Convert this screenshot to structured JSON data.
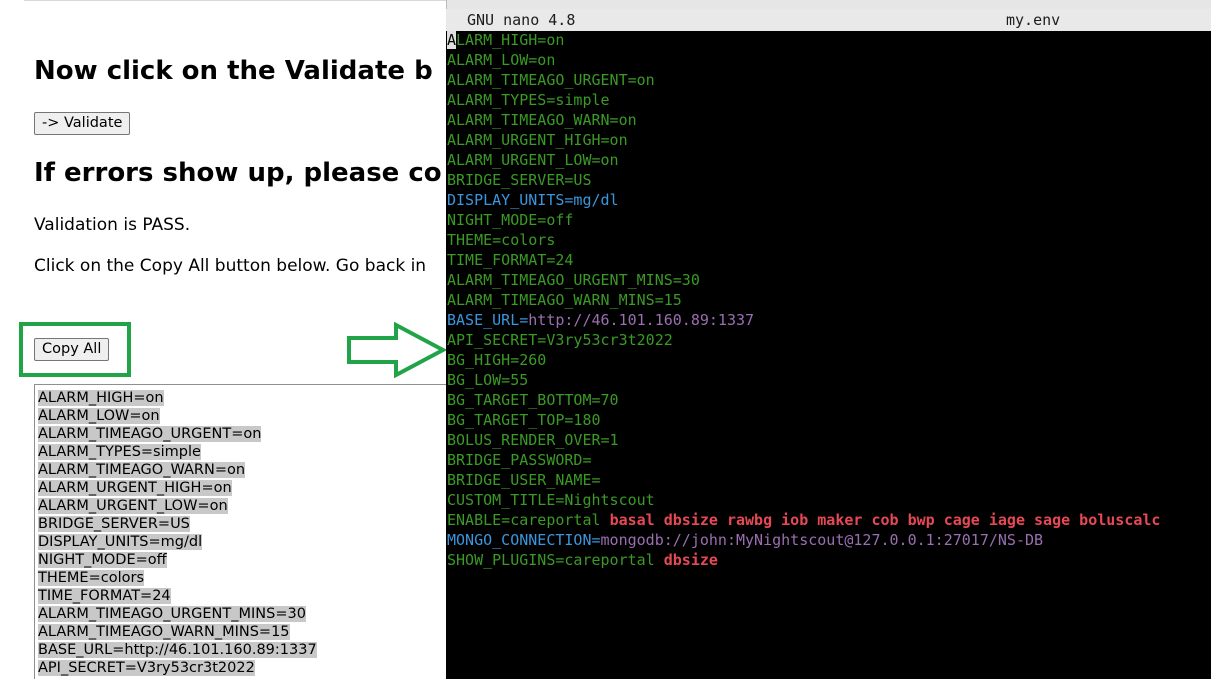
{
  "webpage": {
    "heading_validate": "Now click on the Validate b",
    "validate_button": "-> Validate",
    "heading_errors": "If errors show up, please co",
    "validation_status": "Validation is PASS.",
    "instruction": "Click on the Copy All button below. Go back in",
    "copy_all_button": "Copy All",
    "highlight_color": "#21a347",
    "textarea_lines": [
      "ALARM_HIGH=on",
      "ALARM_LOW=on",
      "ALARM_TIMEAGO_URGENT=on",
      "ALARM_TYPES=simple",
      "ALARM_TIMEAGO_WARN=on",
      "ALARM_URGENT_HIGH=on",
      "ALARM_URGENT_LOW=on",
      "BRIDGE_SERVER=US",
      "DISPLAY_UNITS=mg/dl",
      "NIGHT_MODE=off",
      "THEME=colors",
      "TIME_FORMAT=24",
      "ALARM_TIMEAGO_URGENT_MINS=30",
      "ALARM_TIMEAGO_WARN_MINS=15",
      "BASE_URL=http://46.101.160.89:1337",
      "API_SECRET=V3ry53cr3t2022"
    ]
  },
  "arrow": {
    "color": "#21a347",
    "icon": "right-arrow-icon"
  },
  "terminal": {
    "app_title": "GNU nano 4.8",
    "file_name": "my.env",
    "cursor_char": "A",
    "colors": {
      "green": "#3a9a25",
      "blue": "#3a96dd",
      "purple": "#9a6fb0",
      "red": "#e74856"
    },
    "lines": [
      {
        "segments": [
          {
            "text": "LARM_HIGH=on",
            "color": "green"
          }
        ]
      },
      {
        "segments": [
          {
            "text": "ALARM_LOW=on",
            "color": "green"
          }
        ]
      },
      {
        "segments": [
          {
            "text": "ALARM_TIMEAGO_URGENT=on",
            "color": "green"
          }
        ]
      },
      {
        "segments": [
          {
            "text": "ALARM_TYPES=simple",
            "color": "green"
          }
        ]
      },
      {
        "segments": [
          {
            "text": "ALARM_TIMEAGO_WARN=on",
            "color": "green"
          }
        ]
      },
      {
        "segments": [
          {
            "text": "ALARM_URGENT_HIGH=on",
            "color": "green"
          }
        ]
      },
      {
        "segments": [
          {
            "text": "ALARM_URGENT_LOW=on",
            "color": "green"
          }
        ]
      },
      {
        "segments": [
          {
            "text": "BRIDGE_SERVER=US",
            "color": "green"
          }
        ]
      },
      {
        "segments": [
          {
            "text": "DISPLAY_UNITS=mg/dl",
            "color": "blue"
          }
        ]
      },
      {
        "segments": [
          {
            "text": "NIGHT_MODE=off",
            "color": "green"
          }
        ]
      },
      {
        "segments": [
          {
            "text": "THEME=colors",
            "color": "green"
          }
        ]
      },
      {
        "segments": [
          {
            "text": "TIME_FORMAT=24",
            "color": "green"
          }
        ]
      },
      {
        "segments": [
          {
            "text": "ALARM_TIMEAGO_URGENT_MINS=30",
            "color": "green"
          }
        ]
      },
      {
        "segments": [
          {
            "text": "ALARM_TIMEAGO_WARN_MINS=15",
            "color": "green"
          }
        ]
      },
      {
        "segments": [
          {
            "text": "BASE_URL=",
            "color": "blue"
          },
          {
            "text": "http://46.101.160.89:1337",
            "color": "purple"
          }
        ]
      },
      {
        "segments": [
          {
            "text": "API_SECRET=V3ry53cr3t2022",
            "color": "green"
          }
        ]
      },
      {
        "segments": [
          {
            "text": "BG_HIGH=260",
            "color": "green"
          }
        ]
      },
      {
        "segments": [
          {
            "text": "BG_LOW=55",
            "color": "green"
          }
        ]
      },
      {
        "segments": [
          {
            "text": "BG_TARGET_BOTTOM=70",
            "color": "green"
          }
        ]
      },
      {
        "segments": [
          {
            "text": "BG_TARGET_TOP=180",
            "color": "green"
          }
        ]
      },
      {
        "segments": [
          {
            "text": "BOLUS_RENDER_OVER=1",
            "color": "green"
          }
        ]
      },
      {
        "segments": [
          {
            "text": "BRIDGE_PASSWORD=",
            "color": "green"
          }
        ]
      },
      {
        "segments": [
          {
            "text": "BRIDGE_USER_NAME=",
            "color": "green"
          }
        ]
      },
      {
        "segments": [
          {
            "text": "CUSTOM_TITLE=Nightscout",
            "color": "green"
          }
        ]
      },
      {
        "segments": [
          {
            "text": "ENABLE=careportal ",
            "color": "green"
          },
          {
            "text": "basal dbsize rawbg iob maker cob bwp cage iage sage boluscalc",
            "color": "red"
          }
        ]
      },
      {
        "segments": [
          {
            "text": "MONGO_CONNECTION=",
            "color": "blue"
          },
          {
            "text": "mongodb://john:MyNightscout@127.0.0.1:27017/NS-DB",
            "color": "purple"
          }
        ]
      },
      {
        "segments": [
          {
            "text": "SHOW_PLUGINS=careportal ",
            "color": "green"
          },
          {
            "text": "dbsize",
            "color": "red"
          }
        ]
      }
    ]
  }
}
